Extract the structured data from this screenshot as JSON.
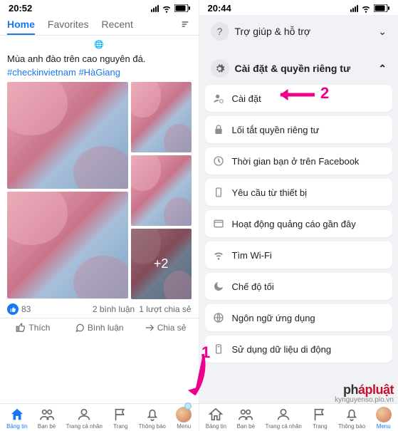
{
  "left": {
    "time": "20:52",
    "tabs": {
      "home": "Home",
      "favorites": "Favorites",
      "recent": "Recent"
    },
    "post": {
      "caption": "Mùa anh đào trên cao nguyên đá.",
      "hashtags": "#checkinvietnam #HàGiang",
      "more_overlay": "+2"
    },
    "reactions": {
      "count": "83",
      "comments": "2 bình luận",
      "shares": "1 lượt chia sẻ"
    },
    "actions": {
      "like": "Thích",
      "comment": "Bình luận",
      "share": "Chia sẻ"
    },
    "nav": {
      "feed": "Bảng tin",
      "friends": "Bạn bè",
      "profile": "Trang cá nhân",
      "pages": "Trang",
      "notifications": "Thông báo",
      "menu": "Menu"
    }
  },
  "right": {
    "time": "20:44",
    "sections": {
      "help": "Trợ giúp & hỗ trợ",
      "settings": "Cài đặt & quyền riêng tư"
    },
    "items": {
      "settings": "Cài đặt",
      "privacy_shortcuts": "Lối tắt quyền riêng tư",
      "time_on_fb": "Thời gian bạn ở trên Facebook",
      "device_requests": "Yêu cầu từ thiết bị",
      "recent_ads": "Hoạt động quảng cáo gần đây",
      "find_wifi": "Tìm Wi-Fi",
      "dark_mode": "Chế độ tối",
      "app_language": "Ngôn ngữ ứng dụng",
      "cellular_data": "Sử dụng dữ liệu di động"
    },
    "nav": {
      "feed": "Bảng tin",
      "friends": "Bạn bè",
      "profile": "Trang cá nhân",
      "pages": "Trang",
      "notifications": "Thông báo",
      "menu": "Menu"
    }
  },
  "annotations": {
    "one": "1",
    "two": "2"
  },
  "watermark": {
    "brand_prefix": "ph",
    "brand": "ápluật",
    "sub": "kynguyenso.plo.vn"
  }
}
